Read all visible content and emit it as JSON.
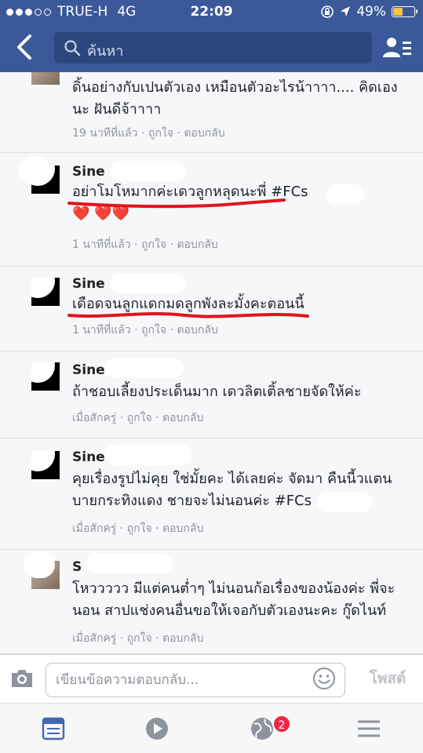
{
  "status_bar": {
    "carrier": "TRUE-H",
    "network": "4G",
    "time": "22:09",
    "battery": "49%",
    "battery_level": 0.49,
    "signal_bars": 3
  },
  "header": {
    "search_placeholder": "ค้นหา"
  },
  "comments": [
    {
      "name": "",
      "text": "ดิ้นอย่างกับเปนตัวเอง เหมือนตัวอะไรน้าาาา.... คิดเองนะ ฝันดีจ้าาาา",
      "time": "19 นาทีที่แล้ว",
      "like": "ถูกใจ",
      "reply": "ตอบกลับ"
    },
    {
      "name": "Sine",
      "text": "อย่าโมโหมากค่ะเดวลูกหลุดนะพี่ #FCs",
      "hearts": "❤️ ❤️❤️",
      "time": "1 นาทีที่แล้ว",
      "like": "ถูกใจ",
      "reply": "ตอบกลับ"
    },
    {
      "name": "Sine",
      "text": "เดือดจนลูกแดกมดลูกพังละมั้งคะตอนนี้",
      "time": "1 นาทีที่แล้ว",
      "like": "ถูกใจ",
      "reply": "ตอบกลับ"
    },
    {
      "name": "Sine",
      "text": "ถ้าชอบเลี้ยงประเด็นมาก เดวลิตเติ้ลชายจัดให้ค่ะ",
      "time": "เมื่อสักครู่",
      "like": "ถูกใจ",
      "reply": "ตอบกลับ"
    },
    {
      "name": "Sine",
      "text": "คุยเรื่องรูปไม่คุย ใช่มั้ยคะ ได้เลยค่ะ จัดมา คืนนี้วแตนบายกระทิงแดง ชายจะไม่นอนค่ะ #FCs",
      "time": "เมื่อสักครู่",
      "like": "ถูกใจ",
      "reply": "ตอบกลับ"
    },
    {
      "name": "S",
      "text": "โหววววว มีแต่คนต่ำๆ ไม่นอนก้อเรื่องของน้องค่ะ พี่จะนอน สาปแช่งคนอื่นขอให้เจอกับตัวเองนะคะ กู๊ดไนท์",
      "time": "เมื่อสักครู่",
      "like": "ถูกใจ",
      "reply": "ตอบกลับ"
    }
  ],
  "reply_bar": {
    "placeholder": "เขียนข้อความตอบกลับ...",
    "post_label": "โพสต์"
  },
  "tab_bar": {
    "notifications_badge": "2"
  },
  "colors": {
    "header_bg": "#3b5998",
    "search_bg": "#2c477e",
    "meta_text": "#90949c",
    "underline": "#e0141e",
    "badge": "#f02849"
  }
}
